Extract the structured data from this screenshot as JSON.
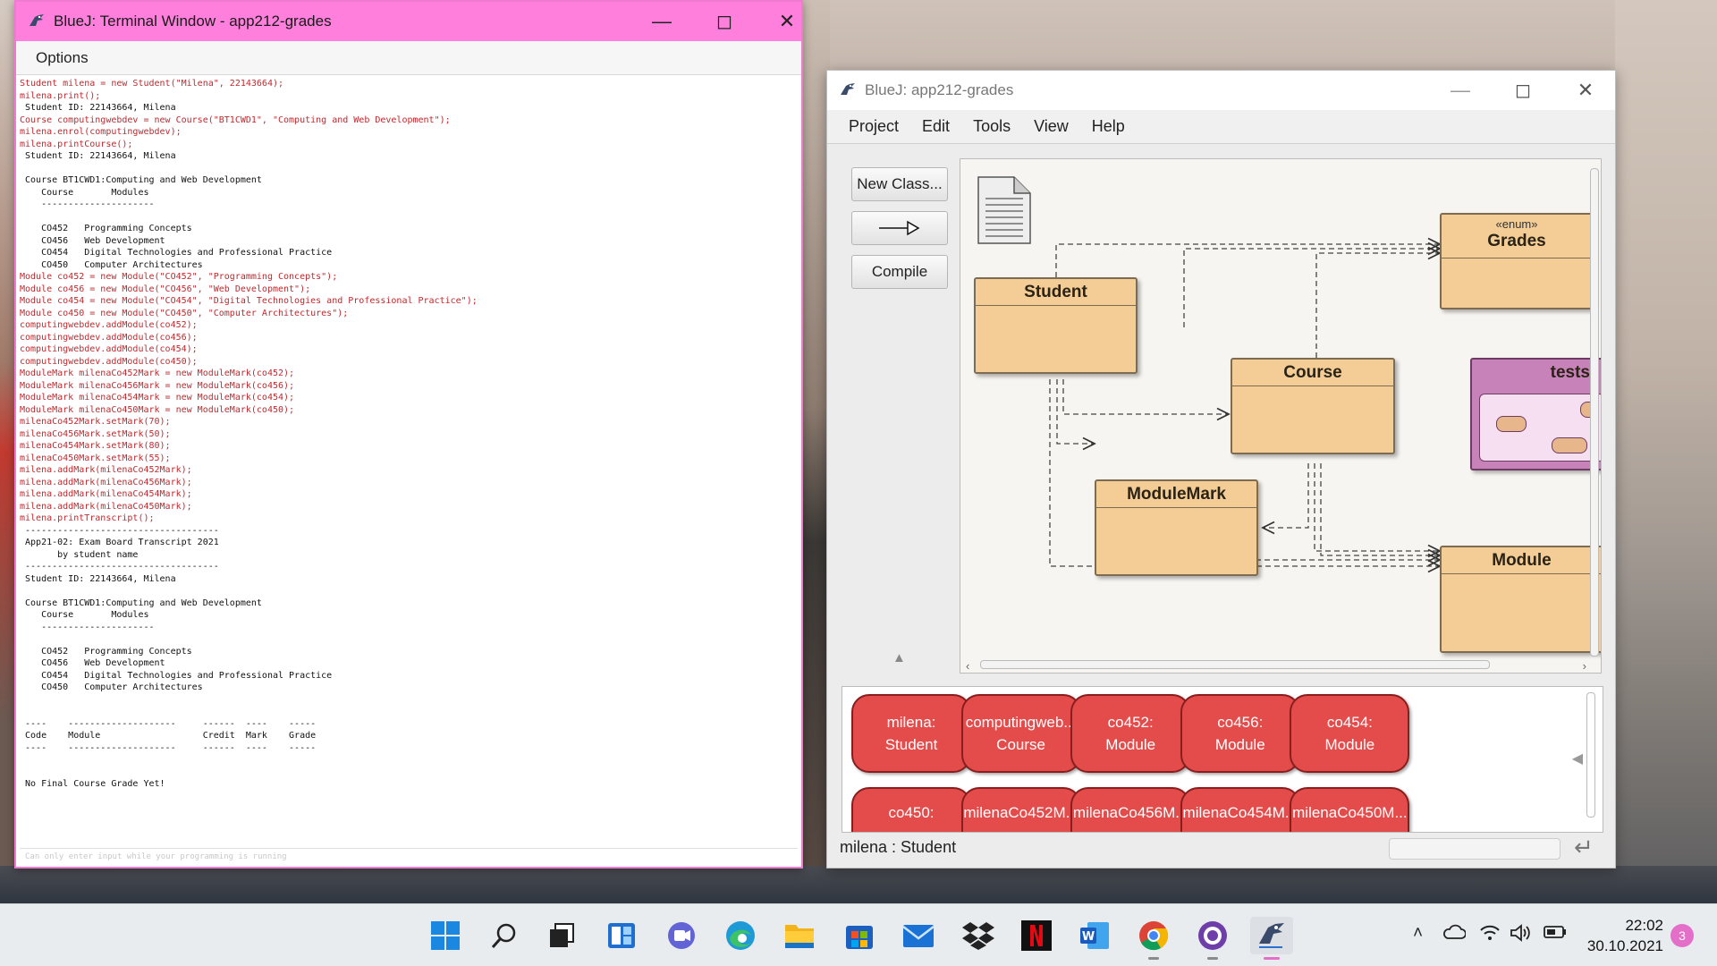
{
  "terminal": {
    "title": "BlueJ: Terminal Window - app212-grades",
    "menu": "Options",
    "lines": [
      {
        "t": "Student milena = new Student(\"Milena\", 22143664);",
        "k": "cmd"
      },
      {
        "t": "milena.print();",
        "k": "cmd"
      },
      {
        "t": " Student ID: 22143664, Milena",
        "k": "out"
      },
      {
        "t": "Course computingwebdev = new Course(\"BT1CWD1\", \"Computing and Web Development\");",
        "k": "cmd"
      },
      {
        "t": "milena.enrol(computingwebdev);",
        "k": "cmd"
      },
      {
        "t": "milena.printCourse();",
        "k": "cmd"
      },
      {
        "t": " Student ID: 22143664, Milena",
        "k": "out"
      },
      {
        "t": "",
        "k": "out"
      },
      {
        "t": " Course BT1CWD1:Computing and Web Development",
        "k": "out"
      },
      {
        "t": "    Course       Modules",
        "k": "out"
      },
      {
        "t": "    ---------------------",
        "k": "out"
      },
      {
        "t": "",
        "k": "out"
      },
      {
        "t": "    CO452   Programming Concepts",
        "k": "out"
      },
      {
        "t": "    CO456   Web Development",
        "k": "out"
      },
      {
        "t": "    CO454   Digital Technologies and Professional Practice",
        "k": "out"
      },
      {
        "t": "    CO450   Computer Architectures",
        "k": "out"
      },
      {
        "t": "Module co452 = new Module(\"CO452\", \"Programming Concepts\");",
        "k": "cmd"
      },
      {
        "t": "Module co456 = new Module(\"CO456\", \"Web Development\");",
        "k": "cmd"
      },
      {
        "t": "Module co454 = new Module(\"CO454\", \"Digital Technologies and Professional Practice\");",
        "k": "cmd"
      },
      {
        "t": "Module co450 = new Module(\"CO450\", \"Computer Architectures\");",
        "k": "cmd"
      },
      {
        "t": "computingwebdev.addModule(co452);",
        "k": "cmd"
      },
      {
        "t": "computingwebdev.addModule(co456);",
        "k": "cmd"
      },
      {
        "t": "computingwebdev.addModule(co454);",
        "k": "cmd"
      },
      {
        "t": "computingwebdev.addModule(co450);",
        "k": "cmd"
      },
      {
        "t": "ModuleMark milenaCo452Mark = new ModuleMark(co452);",
        "k": "cmd"
      },
      {
        "t": "ModuleMark milenaCo456Mark = new ModuleMark(co456);",
        "k": "cmd"
      },
      {
        "t": "ModuleMark milenaCo454Mark = new ModuleMark(co454);",
        "k": "cmd"
      },
      {
        "t": "ModuleMark milenaCo450Mark = new ModuleMark(co450);",
        "k": "cmd"
      },
      {
        "t": "milenaCo452Mark.setMark(70);",
        "k": "cmd"
      },
      {
        "t": "milenaCo456Mark.setMark(50);",
        "k": "cmd"
      },
      {
        "t": "milenaCo454Mark.setMark(80);",
        "k": "cmd"
      },
      {
        "t": "milenaCo450Mark.setMark(55);",
        "k": "cmd"
      },
      {
        "t": "milena.addMark(milenaCo452Mark);",
        "k": "cmd"
      },
      {
        "t": "milena.addMark(milenaCo456Mark);",
        "k": "cmd"
      },
      {
        "t": "milena.addMark(milenaCo454Mark);",
        "k": "cmd"
      },
      {
        "t": "milena.addMark(milenaCo450Mark);",
        "k": "cmd"
      },
      {
        "t": "milena.printTranscript();",
        "k": "cmd"
      },
      {
        "t": " ------------------------------------",
        "k": "out"
      },
      {
        "t": " App21-02: Exam Board Transcript 2021",
        "k": "out"
      },
      {
        "t": "       by student name",
        "k": "out"
      },
      {
        "t": " ------------------------------------",
        "k": "out"
      },
      {
        "t": " Student ID: 22143664, Milena",
        "k": "out"
      },
      {
        "t": "",
        "k": "out"
      },
      {
        "t": " Course BT1CWD1:Computing and Web Development",
        "k": "out"
      },
      {
        "t": "    Course       Modules",
        "k": "out"
      },
      {
        "t": "    ---------------------",
        "k": "out"
      },
      {
        "t": "",
        "k": "out"
      },
      {
        "t": "    CO452   Programming Concepts",
        "k": "out"
      },
      {
        "t": "    CO456   Web Development",
        "k": "out"
      },
      {
        "t": "    CO454   Digital Technologies and Professional Practice",
        "k": "out"
      },
      {
        "t": "    CO450   Computer Architectures",
        "k": "out"
      },
      {
        "t": "",
        "k": "out"
      },
      {
        "t": "",
        "k": "out"
      },
      {
        "t": " ----    --------------------     ------  ----    -----",
        "k": "out"
      },
      {
        "t": " Code    Module                   Credit  Mark    Grade",
        "k": "out"
      },
      {
        "t": " ----    --------------------     ------  ----    -----",
        "k": "out"
      },
      {
        "t": "",
        "k": "out"
      },
      {
        "t": "",
        "k": "out"
      },
      {
        "t": " No Final Course Grade Yet!",
        "k": "out"
      }
    ],
    "input_placeholder": "Can only enter input while your programming is running"
  },
  "bluej": {
    "title": "BlueJ:  app212-grades",
    "menus": [
      "Project",
      "Edit",
      "Tools",
      "View",
      "Help"
    ],
    "buttons": {
      "new_class": "New Class...",
      "compile": "Compile"
    },
    "classes": {
      "grades": {
        "name": "Grades",
        "stereotype": "«enum»"
      },
      "student": {
        "name": "Student"
      },
      "course": {
        "name": "Course"
      },
      "tests": {
        "name": "tests"
      },
      "modulemark": {
        "name": "ModuleMark"
      },
      "module": {
        "name": "Module"
      }
    },
    "objects": [
      {
        "line1": "milena:",
        "line2": "Student"
      },
      {
        "line1": "computingweb...",
        "line2": "Course"
      },
      {
        "line1": "co452:",
        "line2": "Module"
      },
      {
        "line1": "co456:",
        "line2": "Module"
      },
      {
        "line1": "co454:",
        "line2": "Module"
      },
      {
        "line1": "co450:",
        "line2": ""
      },
      {
        "line1": "milenaCo452M...",
        "line2": ""
      },
      {
        "line1": "milenaCo456M...",
        "line2": ""
      },
      {
        "line1": "milenaCo454M...",
        "line2": ""
      },
      {
        "line1": "milenaCo450M...",
        "line2": ""
      }
    ],
    "status": "milena : Student"
  },
  "taskbar": {
    "icons": [
      "windows-start",
      "search",
      "task-view",
      "widgets",
      "teams-chat",
      "edge",
      "file-explorer",
      "microsoft-store",
      "mail",
      "dropbox",
      "netflix",
      "word",
      "chrome",
      "github-desktop",
      "bluej"
    ],
    "time": "22:02",
    "date": "30.10.2021",
    "notifications": "3"
  },
  "colors": {
    "terminal_title": "#ff80dc",
    "class_fill": "#f3cd95",
    "object_fill": "#e44c4b",
    "tests_fill": "#c882ba"
  }
}
